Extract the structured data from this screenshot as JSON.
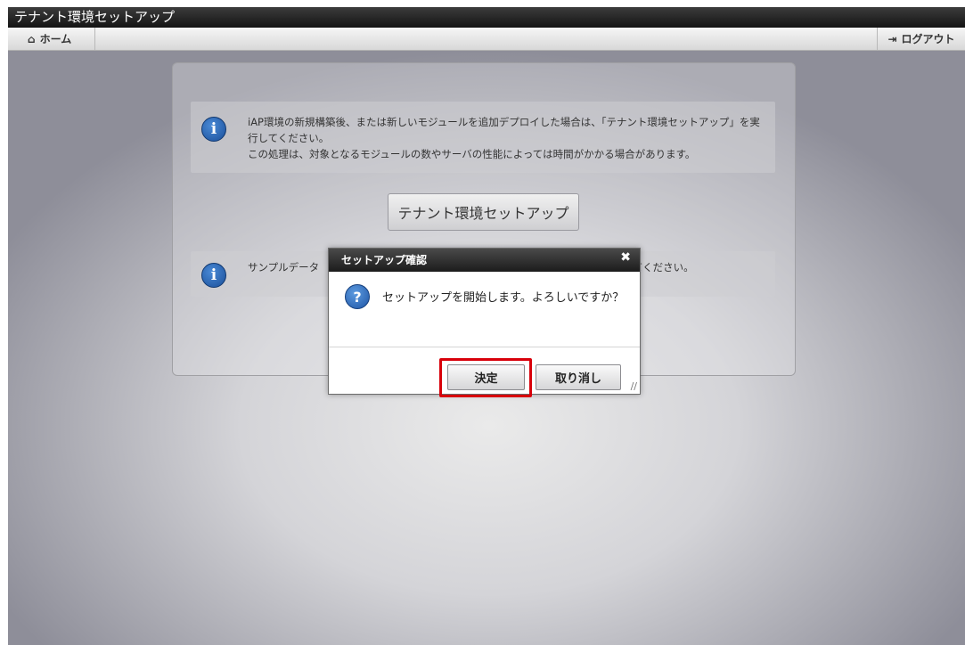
{
  "window": {
    "title": "テナント環境セットアップ"
  },
  "nav": {
    "home_label": "ホーム",
    "logout_label": "ログアウト"
  },
  "info_messages": [
    "iAP環境の新規構築後、または新しいモジュールを追加デプロイした場合は、「テナント環境セットアップ」を実行してください。",
    "この処理は、対象となるモジュールの数やサーバの性能によっては時間がかかる場合があります。"
  ],
  "info2_visible": {
    "left": "サンプルデータ",
    "right": "てください。"
  },
  "setup_button": "テナント環境セットアップ",
  "dialog": {
    "title": "セットアップ確認",
    "message": "セットアップを開始します。よろしいですか？",
    "ok_label": "決定",
    "cancel_label": "取り消し"
  },
  "colors": {
    "highlight": "#d8000a",
    "info_icon": "#1a4f9a",
    "titlebar": "#141414"
  },
  "icons": {
    "home": "house-icon",
    "logout": "logout-icon",
    "info": "info-icon",
    "question": "question-icon",
    "close": "close-icon"
  }
}
